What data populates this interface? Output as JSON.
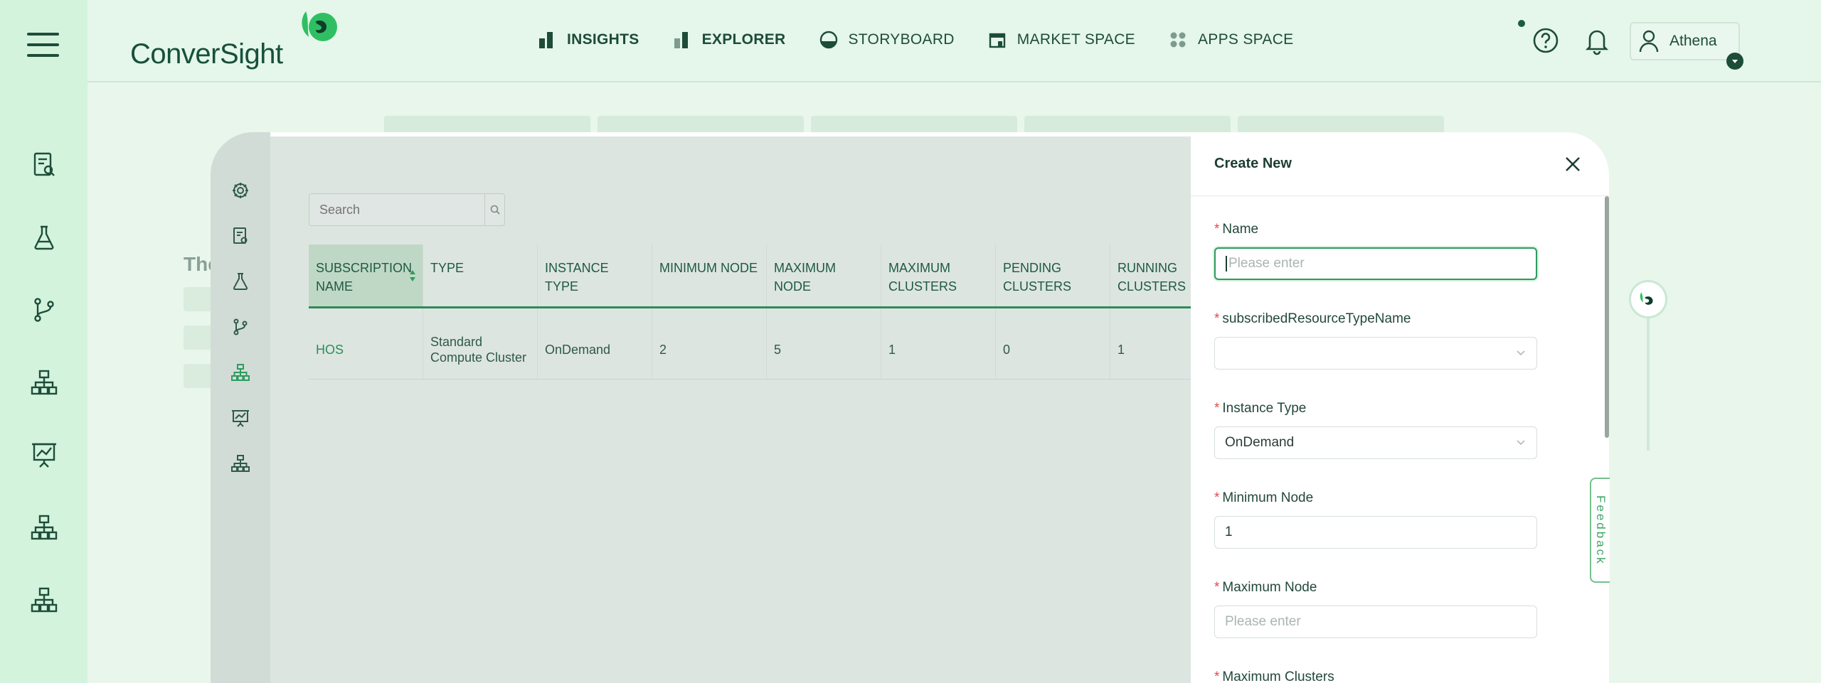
{
  "header": {
    "logo_text": "ConverSight",
    "nav": [
      {
        "label": "INSIGHTS",
        "icon": "bar-chart-icon"
      },
      {
        "label": "EXPLORER",
        "icon": "explorer-icon"
      },
      {
        "label": "STORYBOARD",
        "icon": "storyboard-icon"
      },
      {
        "label": "MARKET SPACE",
        "icon": "market-icon"
      },
      {
        "label": "APPS SPACE",
        "icon": "apps-icon"
      }
    ],
    "user_name": "Athena"
  },
  "background": {
    "title_fragment": "The"
  },
  "search": {
    "placeholder": "Search"
  },
  "table": {
    "columns": [
      "SUBSCRIPTION NAME",
      "TYPE",
      "INSTANCE TYPE",
      "MINIMUM NODE",
      "MAXIMUM NODE",
      "MAXIMUM CLUSTERS",
      "PENDING CLUSTERS",
      "RUNNING CLUSTERS"
    ],
    "rows": [
      [
        "HOS",
        "Standard Compute Cluster",
        "OnDemand",
        "2",
        "5",
        "1",
        "0",
        "1"
      ]
    ]
  },
  "drawer": {
    "title": "Create New",
    "fields": {
      "name": {
        "label": "Name",
        "placeholder": "Please enter",
        "value": ""
      },
      "resource_type": {
        "label": "subscribedResourceTypeName",
        "value": ""
      },
      "instance_type": {
        "label": "Instance Type",
        "value": "OnDemand"
      },
      "min_node": {
        "label": "Minimum Node",
        "value": "1"
      },
      "max_node": {
        "label": "Maximum Node",
        "placeholder": "Please enter",
        "value": ""
      },
      "max_clusters": {
        "label": "Maximum Clusters"
      }
    }
  },
  "feedback_label": "Feedback",
  "colors": {
    "brand": "#1d4c39",
    "accent": "#2e9b5e",
    "required": "#e04b4b"
  }
}
